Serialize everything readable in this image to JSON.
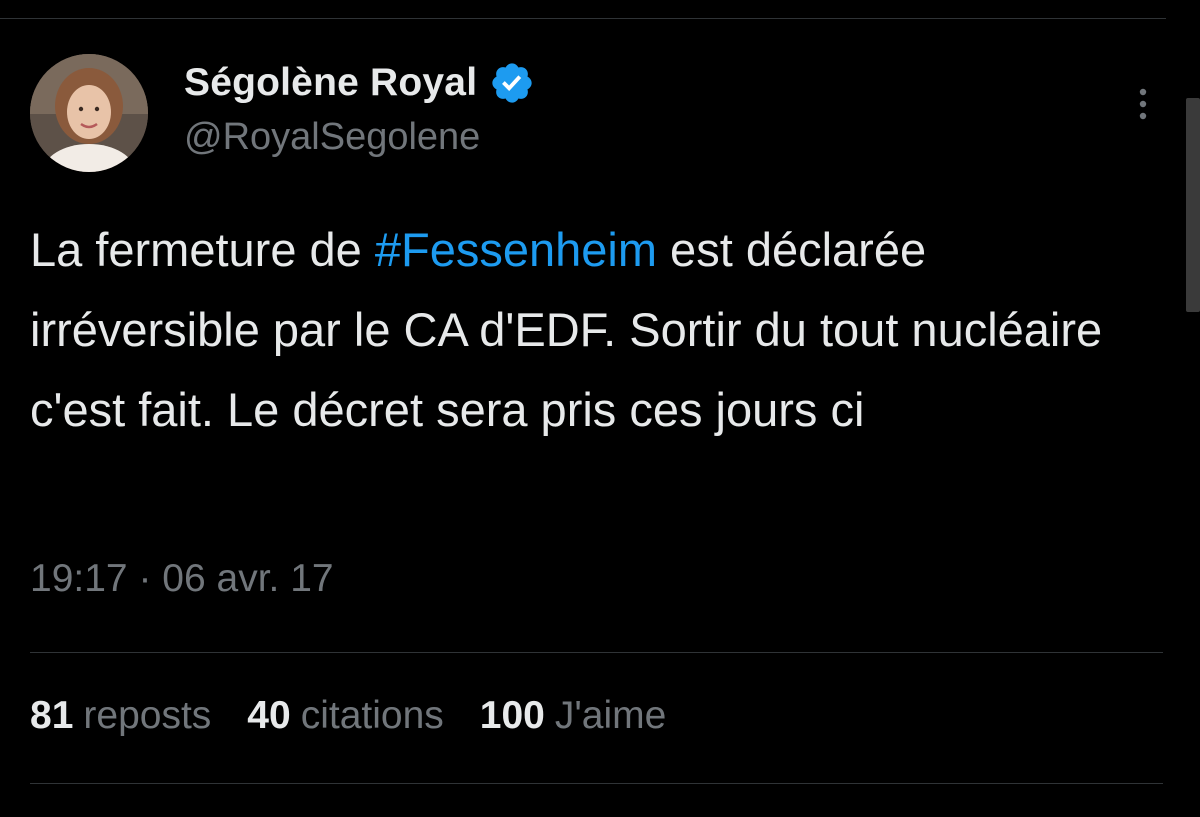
{
  "author": {
    "display_name": "Ségolène Royal",
    "handle": "@RoyalSegolene",
    "verified": true,
    "verified_color": "#1d9bf0"
  },
  "tweet": {
    "text_before": "La fermeture de ",
    "hashtag": "#Fessenheim",
    "text_after": " est déclarée irréversible par le CA d'EDF. Sortir du tout nucléaire c'est fait. Le décret sera pris ces jours ci",
    "time": "19:17",
    "separator": "·",
    "date": "06 avr. 17"
  },
  "stats": {
    "reposts_count": "81",
    "reposts_label": "reposts",
    "quotes_count": "40",
    "quotes_label": "citations",
    "likes_count": "100",
    "likes_label": "J'aime"
  },
  "colors": {
    "background": "#000000",
    "text_primary": "#e7e9ea",
    "text_secondary": "#71767b",
    "accent": "#1d9bf0",
    "divider": "#2f3336"
  },
  "icons": {
    "verified": "verified-badge-icon",
    "more": "more-options-icon"
  }
}
